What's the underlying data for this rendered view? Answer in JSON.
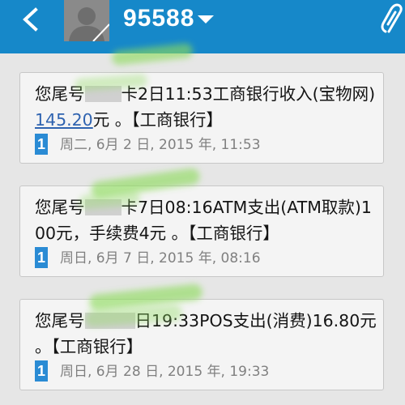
{
  "header": {
    "contact": "95588",
    "accent_color": "#1688c9",
    "icons": [
      "back-arrow-icon",
      "avatar",
      "dropdown-caret-icon",
      "paperclip-icon"
    ]
  },
  "messages": [
    {
      "pre": "您尾号",
      "post": "卡2日11:53工商银行收入(宝物网)",
      "amount": "145.20",
      "tail": "元 。【工商银行】",
      "sim": "1",
      "timestamp": "周二, 6月 2 日, 2015 年, 11:53"
    },
    {
      "pre": "您尾号",
      "post": "卡7日08:16ATM支出(ATM取款)100元，手续费4元 。【工商银行】",
      "sim": "1",
      "timestamp": "周日, 6月 7 日, 2015 年, 08:16"
    },
    {
      "pre": "您尾号",
      "post": "日19:33POS支出(消费)16.80元 。【工商银行】",
      "sim": "1",
      "timestamp": "周日, 6月 28 日, 2015 年, 19:33"
    }
  ]
}
